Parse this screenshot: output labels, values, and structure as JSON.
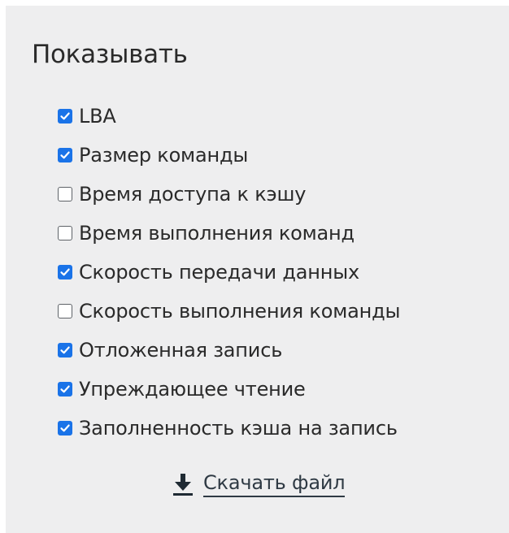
{
  "panel": {
    "title": "Показывать"
  },
  "colors": {
    "panel_background": "#eeeeef",
    "checkbox_accent": "#1a73e8",
    "text": "#2a2a2a"
  },
  "options": [
    {
      "label": "LBA",
      "checked": true
    },
    {
      "label": "Размер команды",
      "checked": true
    },
    {
      "label": "Время доступа к кэшу",
      "checked": false
    },
    {
      "label": "Время выполнения команд",
      "checked": false
    },
    {
      "label": "Скорость передачи данных",
      "checked": true
    },
    {
      "label": "Скорость выполнения команды",
      "checked": false
    },
    {
      "label": "Отложенная запись",
      "checked": true
    },
    {
      "label": "Упреждающее чтение",
      "checked": true
    },
    {
      "label": "Заполненность кэша на запись",
      "checked": true
    }
  ],
  "download": {
    "label": "Скачать файл",
    "icon": "download-icon"
  }
}
